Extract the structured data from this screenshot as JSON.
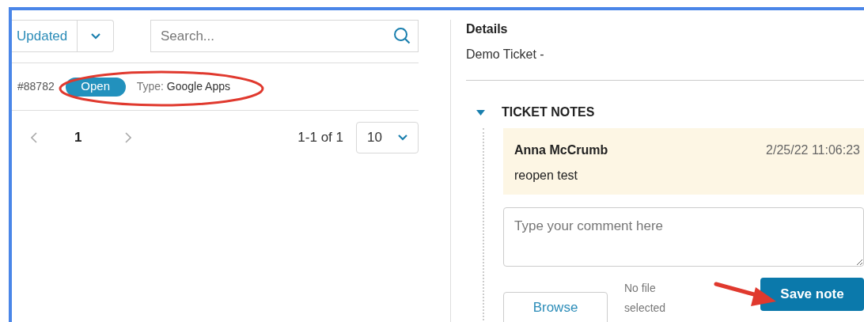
{
  "sort": {
    "label": "Updated"
  },
  "search": {
    "placeholder": "Search..."
  },
  "ticket_row": {
    "number": "#88782",
    "status": "Open",
    "type_label": "Type:",
    "type_value": "Google Apps"
  },
  "pagination": {
    "pages": [
      {
        "label": "1",
        "selected": true
      }
    ],
    "range": "1-1 of 1",
    "page_size": "10"
  },
  "details": {
    "heading": "Details",
    "title": "Demo Ticket -"
  },
  "ticket_notes": {
    "heading": "TICKET NOTES",
    "expanded": true,
    "notes": [
      {
        "author": "Anna McCrumb",
        "time": "2/25/22 11:06:23",
        "text": "reopen test"
      }
    ],
    "comment": {
      "placeholder": "Type your comment here"
    },
    "browse": "Browse",
    "file_status": "No file selected",
    "save": "Save note"
  },
  "annotations": [
    {
      "kind": "ellipse"
    },
    {
      "kind": "arrow"
    }
  ]
}
